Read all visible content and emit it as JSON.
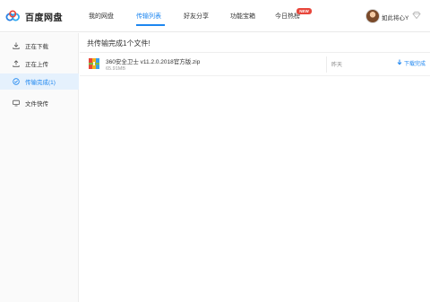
{
  "app": {
    "name": "百度网盘",
    "accent_color": "#1d86f0"
  },
  "header": {
    "nav": [
      {
        "label": "我的网盘",
        "active": false
      },
      {
        "label": "传输列表",
        "active": true
      },
      {
        "label": "好友分享",
        "active": false
      },
      {
        "label": "功能宝箱",
        "active": false
      },
      {
        "label": "今日热榜",
        "active": false,
        "badge": "NEW"
      }
    ],
    "user": {
      "name": "如此将心Y",
      "vip_icon": "diamond-icon"
    }
  },
  "sidebar": {
    "items": [
      {
        "label": "正在下载",
        "icon": "download-icon",
        "active": false
      },
      {
        "label": "正在上传",
        "icon": "upload-icon",
        "active": false
      },
      {
        "label": "传输完成(1)",
        "icon": "check-circle-icon",
        "active": true
      },
      {
        "label": "文件快传",
        "icon": "monitor-icon",
        "active": false
      }
    ]
  },
  "main": {
    "title": "共传输完成1个文件!",
    "files": [
      {
        "name": "360安全卫士 v11.2.0.2018官方版.zip",
        "size": "65.91MB",
        "time": "昨天",
        "action": "下载完成",
        "icon": "zip-archive-icon"
      }
    ]
  }
}
